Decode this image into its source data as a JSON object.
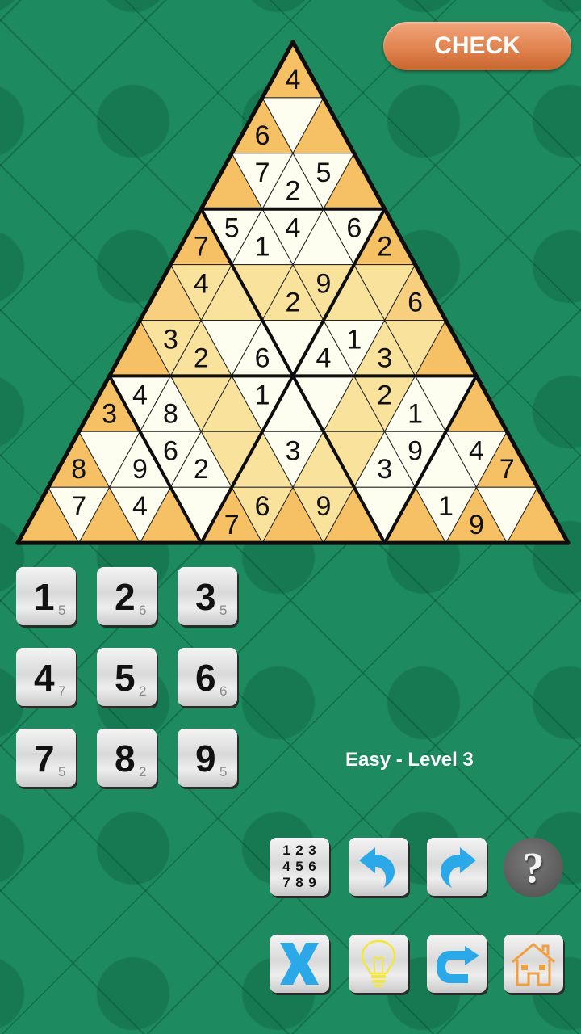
{
  "header": {
    "check_label": "CHECK"
  },
  "colors": {
    "orange": "#F5C164",
    "orange_light": "#F8CF7E",
    "yellow": "#F9E29C",
    "white": "#FDFDF0",
    "line": "#111111",
    "accent_blue": "#2BA8E8",
    "check_button": "#E08450"
  },
  "puzzle": {
    "rows": 9,
    "cells": [
      [
        {
          "c": "orange",
          "v": "4"
        }
      ],
      [
        {
          "c": "orange",
          "v": "6"
        },
        {
          "c": "white",
          "v": ""
        },
        {
          "c": "orange",
          "v": ""
        }
      ],
      [
        {
          "c": "orange",
          "v": ""
        },
        {
          "c": "white",
          "v": "7"
        },
        {
          "c": "white",
          "v": "2"
        },
        {
          "c": "white",
          "v": "5"
        },
        {
          "c": "orange",
          "v": ""
        }
      ],
      [
        {
          "c": "orange",
          "v": "7"
        },
        {
          "c": "white",
          "v": "5"
        },
        {
          "c": "white",
          "v": "1"
        },
        {
          "c": "white",
          "v": "4"
        },
        {
          "c": "white",
          "v": ""
        },
        {
          "c": "white",
          "v": "6"
        },
        {
          "c": "orange",
          "v": "2"
        }
      ],
      [
        {
          "c": "orange_light",
          "v": ""
        },
        {
          "c": "yellow",
          "v": "4"
        },
        {
          "c": "yellow",
          "v": ""
        },
        {
          "c": "yellow",
          "v": ""
        },
        {
          "c": "yellow",
          "v": "2"
        },
        {
          "c": "yellow",
          "v": "9"
        },
        {
          "c": "yellow",
          "v": ""
        },
        {
          "c": "yellow",
          "v": ""
        },
        {
          "c": "orange_light",
          "v": "6"
        }
      ],
      [
        {
          "c": "orange",
          "v": ""
        },
        {
          "c": "yellow",
          "v": "3"
        },
        {
          "c": "yellow",
          "v": "2"
        },
        {
          "c": "white",
          "v": ""
        },
        {
          "c": "white",
          "v": "6"
        },
        {
          "c": "white",
          "v": ""
        },
        {
          "c": "white",
          "v": "4"
        },
        {
          "c": "white",
          "v": "1"
        },
        {
          "c": "yellow",
          "v": "3"
        },
        {
          "c": "yellow",
          "v": ""
        },
        {
          "c": "orange",
          "v": ""
        }
      ],
      [
        {
          "c": "orange",
          "v": "3"
        },
        {
          "c": "white",
          "v": "4"
        },
        {
          "c": "white",
          "v": "8"
        },
        {
          "c": "yellow",
          "v": ""
        },
        {
          "c": "yellow",
          "v": ""
        },
        {
          "c": "white",
          "v": "1"
        },
        {
          "c": "white",
          "v": ""
        },
        {
          "c": "white",
          "v": ""
        },
        {
          "c": "yellow",
          "v": ""
        },
        {
          "c": "yellow",
          "v": "2"
        },
        {
          "c": "white",
          "v": "1"
        },
        {
          "c": "white",
          "v": ""
        },
        {
          "c": "orange",
          "v": ""
        }
      ],
      [
        {
          "c": "orange",
          "v": "8"
        },
        {
          "c": "white",
          "v": ""
        },
        {
          "c": "white",
          "v": "9"
        },
        {
          "c": "white",
          "v": "6"
        },
        {
          "c": "white",
          "v": "2"
        },
        {
          "c": "yellow",
          "v": ""
        },
        {
          "c": "yellow",
          "v": ""
        },
        {
          "c": "white",
          "v": "3"
        },
        {
          "c": "yellow",
          "v": ""
        },
        {
          "c": "yellow",
          "v": ""
        },
        {
          "c": "white",
          "v": "3"
        },
        {
          "c": "white",
          "v": "9"
        },
        {
          "c": "white",
          "v": ""
        },
        {
          "c": "white",
          "v": "4"
        },
        {
          "c": "orange",
          "v": "7"
        }
      ],
      [
        {
          "c": "orange",
          "v": ""
        },
        {
          "c": "white",
          "v": "7"
        },
        {
          "c": "orange",
          "v": ""
        },
        {
          "c": "white",
          "v": "4"
        },
        {
          "c": "orange",
          "v": ""
        },
        {
          "c": "white",
          "v": ""
        },
        {
          "c": "orange",
          "v": "7"
        },
        {
          "c": "yellow",
          "v": "6"
        },
        {
          "c": "orange",
          "v": ""
        },
        {
          "c": "yellow",
          "v": "9"
        },
        {
          "c": "orange",
          "v": ""
        },
        {
          "c": "white",
          "v": ""
        },
        {
          "c": "orange",
          "v": ""
        },
        {
          "c": "white",
          "v": "1"
        },
        {
          "c": "orange",
          "v": "9"
        },
        {
          "c": "white",
          "v": ""
        },
        {
          "c": "orange",
          "v": ""
        }
      ]
    ]
  },
  "number_pad": [
    {
      "digit": "1",
      "remaining": "5"
    },
    {
      "digit": "2",
      "remaining": "6"
    },
    {
      "digit": "3",
      "remaining": "5"
    },
    {
      "digit": "4",
      "remaining": "7"
    },
    {
      "digit": "5",
      "remaining": "2"
    },
    {
      "digit": "6",
      "remaining": "6"
    },
    {
      "digit": "7",
      "remaining": "5"
    },
    {
      "digit": "8",
      "remaining": "2"
    },
    {
      "digit": "9",
      "remaining": "5"
    }
  ],
  "status": {
    "level_label": "Easy - Level 3"
  },
  "toolbar": {
    "notes_grid": [
      "1",
      "2",
      "3",
      "4",
      "5",
      "6",
      "7",
      "8",
      "9"
    ],
    "help_label": "?",
    "buttons": [
      {
        "name": "notes-button",
        "icon": "number-grid-icon"
      },
      {
        "name": "undo-button",
        "icon": "undo-arrow-icon"
      },
      {
        "name": "redo-button",
        "icon": "redo-arrow-icon"
      },
      {
        "name": "help-button",
        "icon": "question-mark-icon"
      },
      {
        "name": "erase-button",
        "icon": "x-icon"
      },
      {
        "name": "hint-button",
        "icon": "lightbulb-icon"
      },
      {
        "name": "restart-button",
        "icon": "restart-arrow-icon"
      },
      {
        "name": "home-button",
        "icon": "home-icon"
      }
    ]
  }
}
